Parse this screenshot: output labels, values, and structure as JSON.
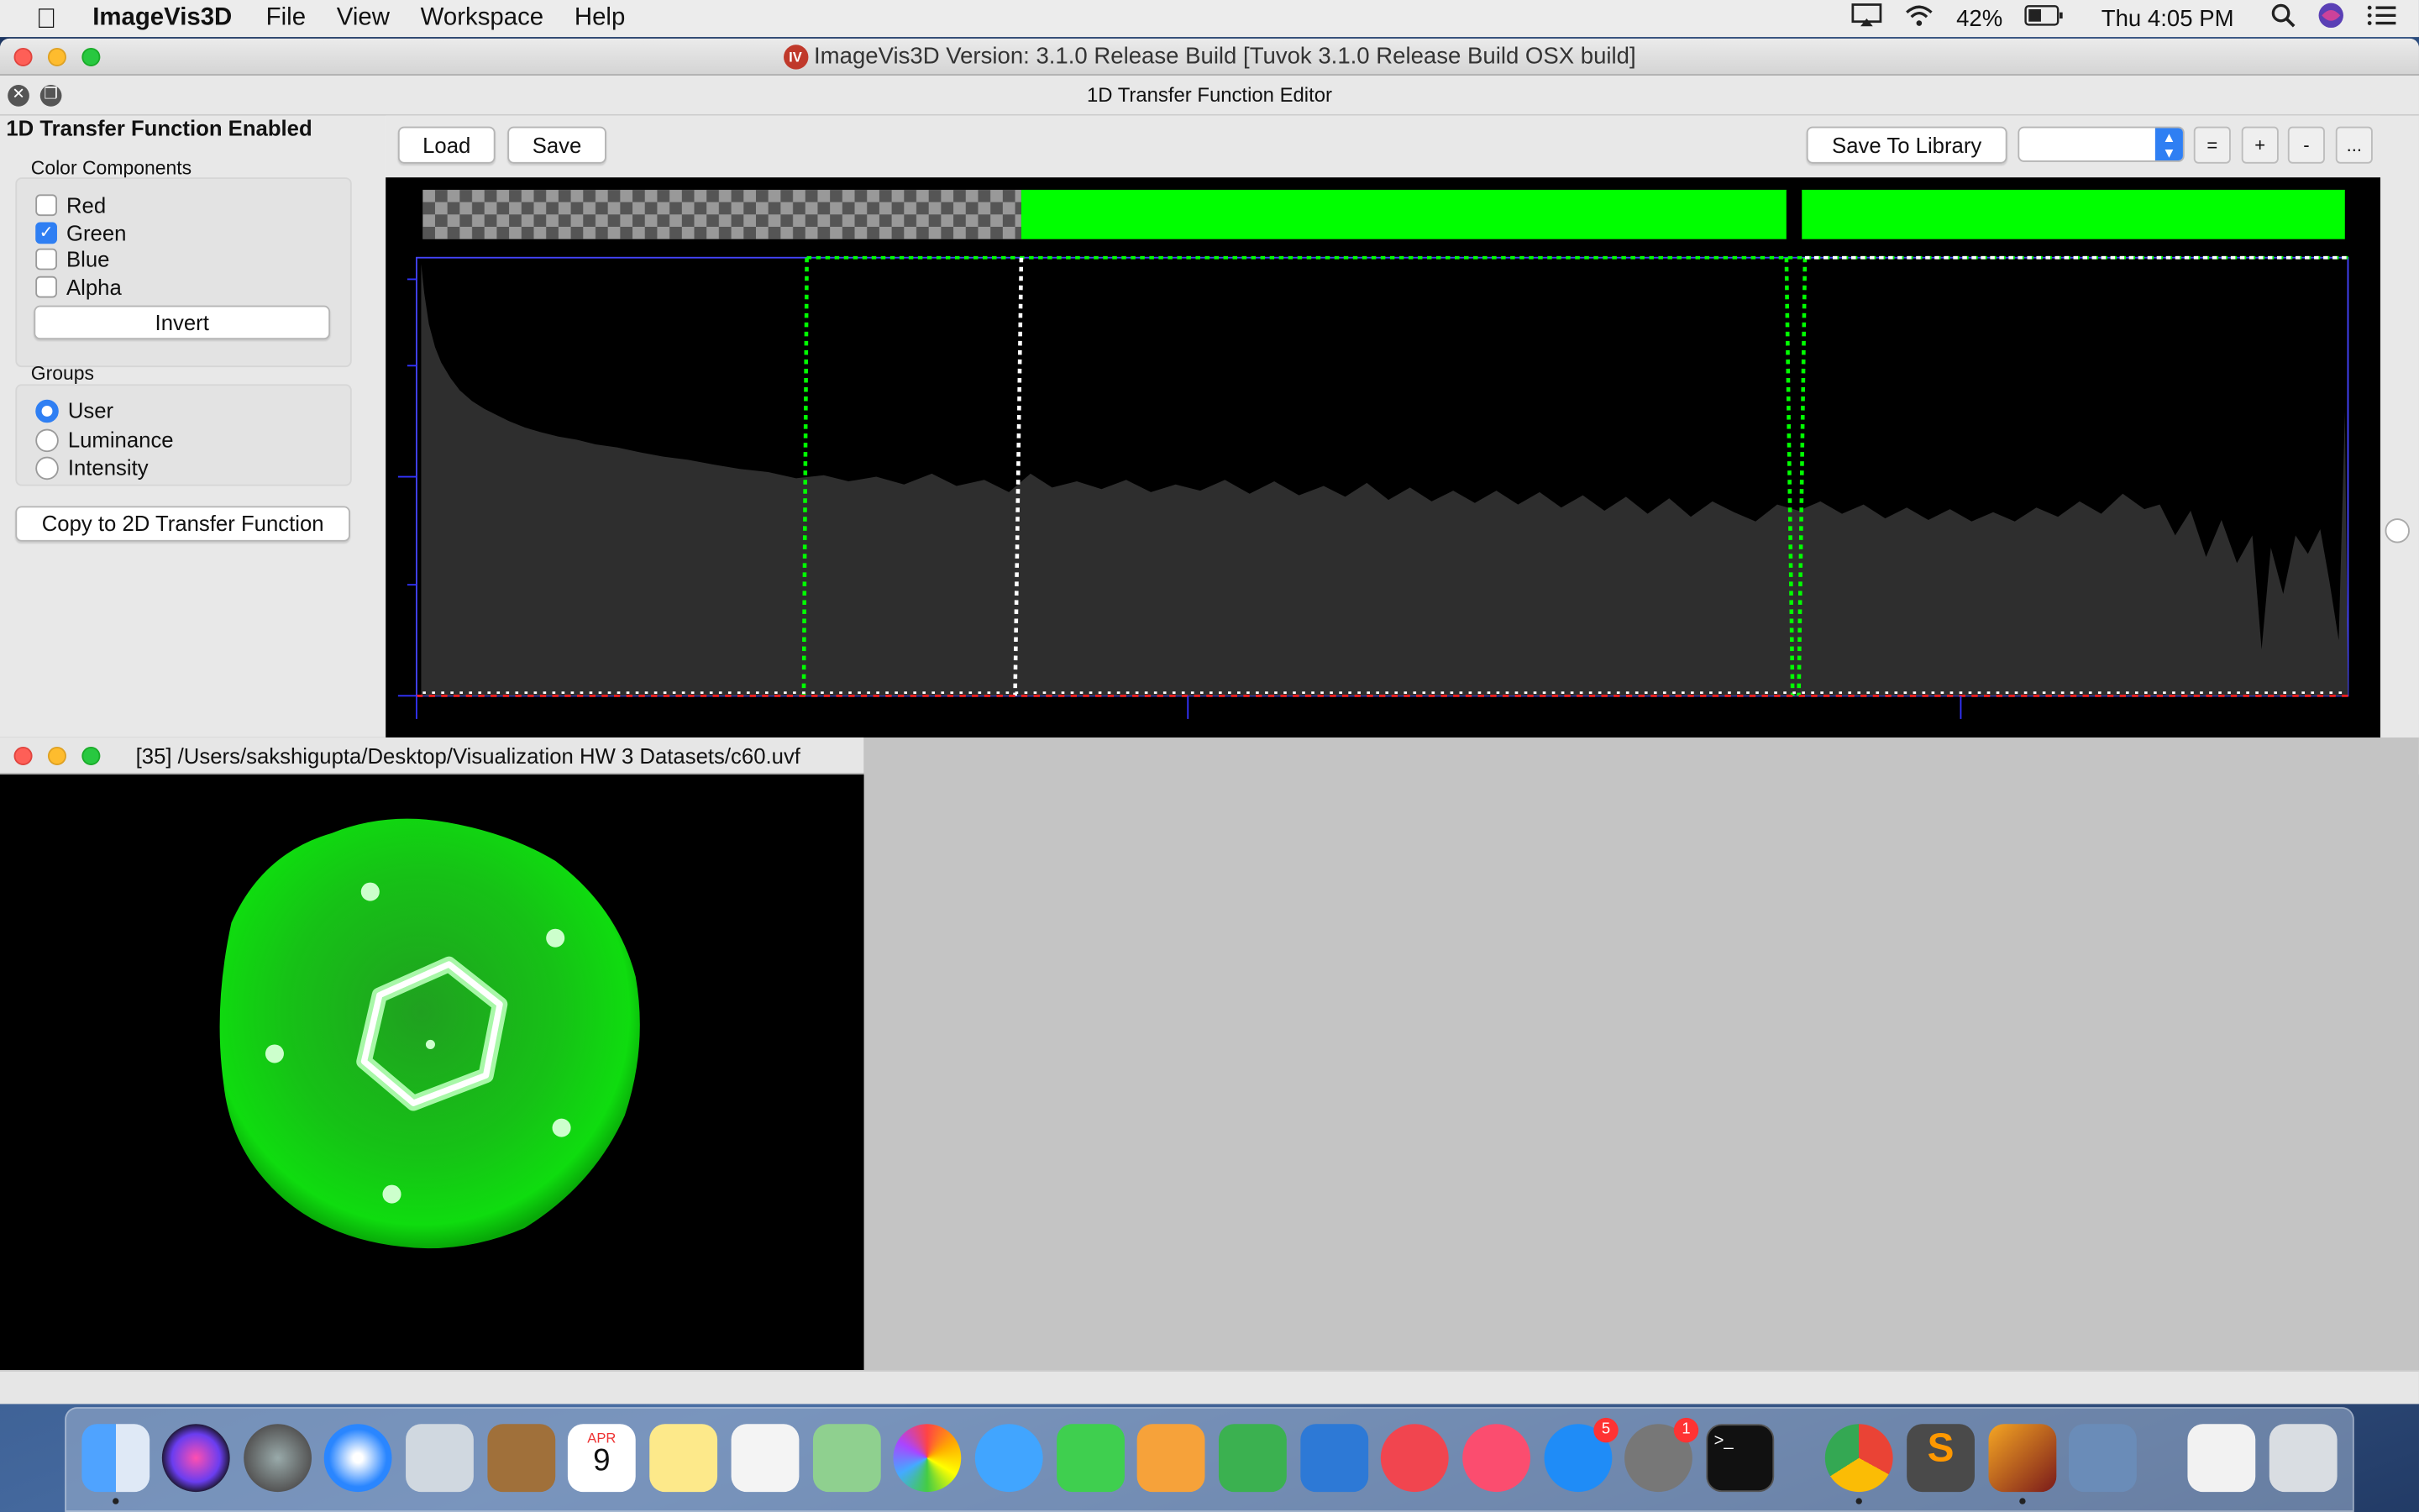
{
  "menubar": {
    "app_name": "ImageVis3D",
    "items": [
      "File",
      "View",
      "Workspace",
      "Help"
    ],
    "battery": "42%",
    "clock": "Thu 4:05 PM"
  },
  "main_window": {
    "title": "ImageVis3D Version: 3.1.0 Release Build [Tuvok 3.1.0 Release Build OSX build]"
  },
  "tf_editor": {
    "title": "1D Transfer Function Editor",
    "enabled_label": "1D Transfer Function Enabled",
    "color_components": {
      "label": "Color Components",
      "items": [
        {
          "label": "Red",
          "checked": false
        },
        {
          "label": "Green",
          "checked": true
        },
        {
          "label": "Blue",
          "checked": false
        },
        {
          "label": "Alpha",
          "checked": false
        }
      ],
      "invert_label": "Invert"
    },
    "groups": {
      "label": "Groups",
      "items": [
        {
          "label": "User",
          "selected": true
        },
        {
          "label": "Luminance",
          "selected": false
        },
        {
          "label": "Intensity",
          "selected": false
        }
      ]
    },
    "copy_label": "Copy to 2D Transfer Function",
    "load_label": "Load",
    "save_label": "Save",
    "save_library_label": "Save To Library",
    "library_value": "",
    "small_buttons": [
      "=",
      "+",
      "-",
      "..."
    ]
  },
  "render_window": {
    "title": "[35] /Users/sakshigupta/Desktop/Visualization HW 3 Datasets/c60.uvf"
  },
  "dock": {
    "calendar_month": "APR",
    "calendar_day": "9",
    "badges": {
      "appstore": "5",
      "preferences": "1"
    }
  },
  "colors": {
    "accent": "#2f7ff3",
    "tf_green": "#00ff00",
    "histogram": "#2e2e2e"
  },
  "icons": [
    "apple-icon",
    "airplay-icon",
    "wifi-icon",
    "battery-icon",
    "search-icon",
    "siri-icon",
    "list-icon"
  ]
}
